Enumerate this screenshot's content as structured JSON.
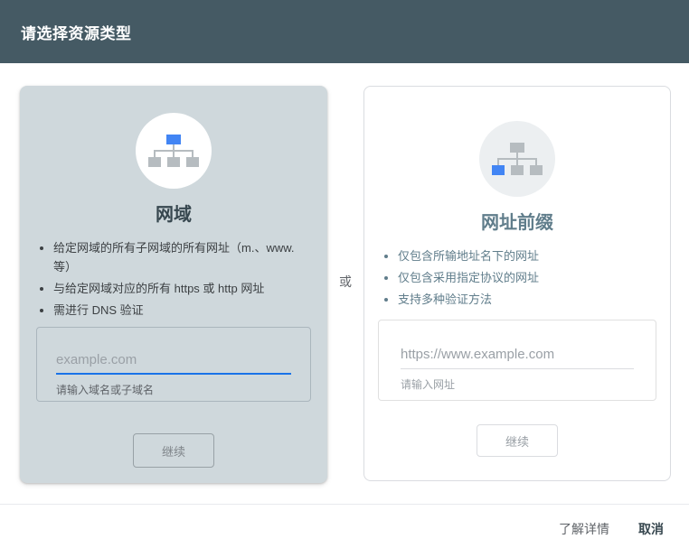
{
  "header": {
    "title": "请选择资源类型"
  },
  "divider_label": "或",
  "cards": {
    "domain": {
      "title": "网域",
      "icon": "sitemap-icon-top-highlighted",
      "bullets": [
        "给定网域的所有子网域的所有网址（m.、www. 等）",
        "与给定网域对应的所有 https 或 http 网址",
        "需进行 DNS 验证"
      ],
      "input": {
        "value": "",
        "placeholder": "example.com",
        "helper": "请输入域名或子域名"
      },
      "button_label": "继续"
    },
    "url_prefix": {
      "title": "网址前缀",
      "icon": "sitemap-icon-leaf-highlighted",
      "bullets": [
        "仅包含所输地址名下的网址",
        "仅包含采用指定协议的网址",
        "支持多种验证方法"
      ],
      "input": {
        "value": "",
        "placeholder": "https://www.example.com",
        "helper": "请输入网址"
      },
      "button_label": "继续"
    }
  },
  "footer": {
    "learn_more": "了解详情",
    "cancel": "取消"
  },
  "colors": {
    "header_bg": "#455a64",
    "domain_card_bg": "#cfd8dc",
    "circle_prefix_bg": "#eceff1",
    "accent_blue": "#4285f4",
    "focus_underline": "#1a73e8",
    "icon_gray": "#b6bcc0"
  }
}
